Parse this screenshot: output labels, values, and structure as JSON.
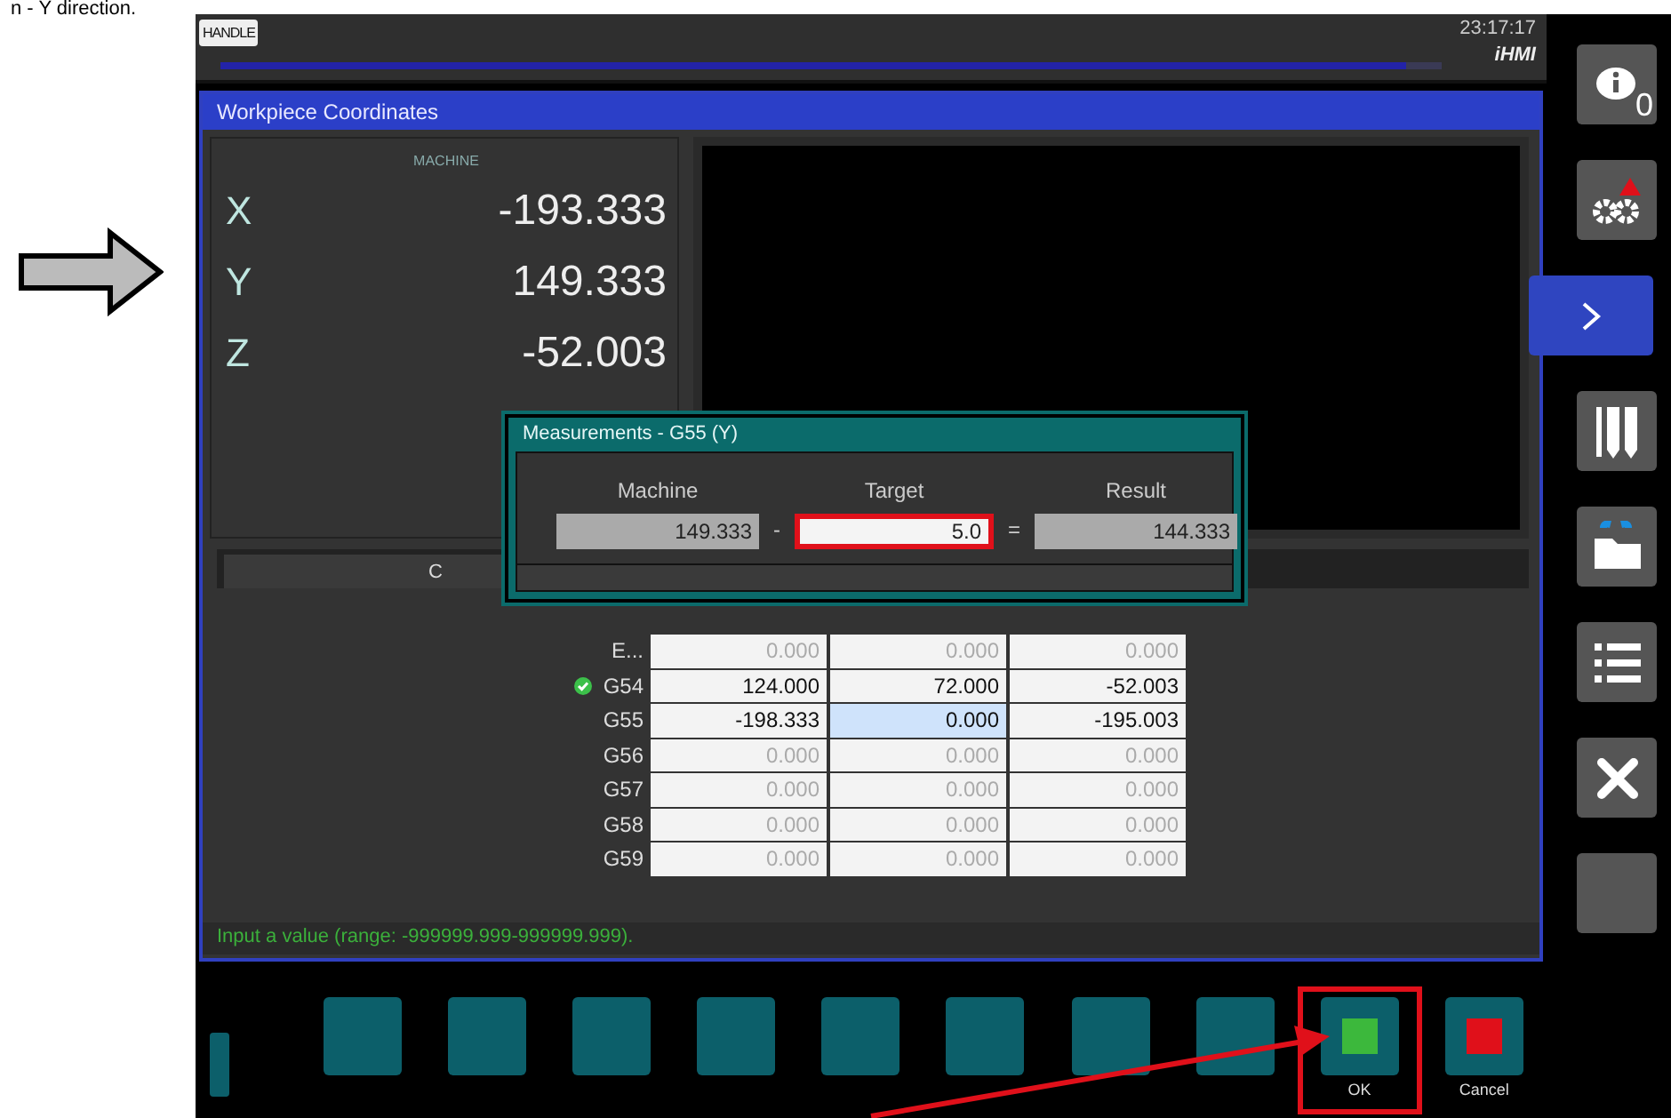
{
  "caption": "n - Y direction.",
  "header": {
    "mode_badge": "HANDLE",
    "progress": {
      "level": 0.97
    },
    "time": "23:17:17",
    "brand": "iHMI"
  },
  "sidebar": {
    "items": [
      {
        "kind": "info",
        "badge": "0",
        "selected": false
      },
      {
        "kind": "gears",
        "alert": true,
        "selected": false
      },
      {
        "kind": "chevron",
        "selected": true
      },
      {
        "kind": "tools",
        "selected": false
      },
      {
        "kind": "folder",
        "selected": false
      },
      {
        "kind": "list",
        "selected": false
      },
      {
        "kind": "wrench",
        "selected": false
      },
      {
        "kind": "blank",
        "selected": false
      }
    ]
  },
  "panel": {
    "title": "Workpiece Coordinates",
    "position": {
      "heading": "MACHINE",
      "axes": [
        {
          "axis": "X",
          "value": "-193.333"
        },
        {
          "axis": "Y",
          "value": "149.333"
        },
        {
          "axis": "Z",
          "value": "-52.003"
        }
      ]
    },
    "tab_label": "C",
    "table": {
      "rows": [
        {
          "name": "E...",
          "active": false,
          "cells": [
            {
              "value": "0.000",
              "set": false,
              "selected": false
            },
            {
              "value": "0.000",
              "set": false,
              "selected": false
            },
            {
              "value": "0.000",
              "set": false,
              "selected": false
            }
          ]
        },
        {
          "name": "G54",
          "active": true,
          "cells": [
            {
              "value": "124.000",
              "set": true,
              "selected": false
            },
            {
              "value": "72.000",
              "set": true,
              "selected": false
            },
            {
              "value": "-52.003",
              "set": true,
              "selected": false
            }
          ]
        },
        {
          "name": "G55",
          "active": false,
          "cells": [
            {
              "value": "-198.333",
              "set": true,
              "selected": false
            },
            {
              "value": "0.000",
              "set": true,
              "selected": true
            },
            {
              "value": "-195.003",
              "set": true,
              "selected": false
            }
          ]
        },
        {
          "name": "G56",
          "active": false,
          "cells": [
            {
              "value": "0.000",
              "set": false,
              "selected": false
            },
            {
              "value": "0.000",
              "set": false,
              "selected": false
            },
            {
              "value": "0.000",
              "set": false,
              "selected": false
            }
          ]
        },
        {
          "name": "G57",
          "active": false,
          "cells": [
            {
              "value": "0.000",
              "set": false,
              "selected": false
            },
            {
              "value": "0.000",
              "set": false,
              "selected": false
            },
            {
              "value": "0.000",
              "set": false,
              "selected": false
            }
          ]
        },
        {
          "name": "G58",
          "active": false,
          "cells": [
            {
              "value": "0.000",
              "set": false,
              "selected": false
            },
            {
              "value": "0.000",
              "set": false,
              "selected": false
            },
            {
              "value": "0.000",
              "set": false,
              "selected": false
            }
          ]
        },
        {
          "name": "G59",
          "active": false,
          "cells": [
            {
              "value": "0.000",
              "set": false,
              "selected": false
            },
            {
              "value": "0.000",
              "set": false,
              "selected": false
            },
            {
              "value": "0.000",
              "set": false,
              "selected": false
            }
          ]
        }
      ]
    },
    "status": "Input a value (range: -999999.999-999999.999)."
  },
  "dialog": {
    "title": "Measurements - G55 (Y)",
    "fields": [
      {
        "label": "Machine",
        "value": "149.333",
        "editable": false
      },
      {
        "label": "Target",
        "value": "5.0",
        "editable": true
      },
      {
        "label": "Result",
        "value": "144.333",
        "editable": false
      }
    ],
    "operators": [
      "-",
      "="
    ]
  },
  "softkeys": [
    {
      "kind": "blank"
    },
    {
      "kind": "blank"
    },
    {
      "kind": "blank"
    },
    {
      "kind": "blank"
    },
    {
      "kind": "blank"
    },
    {
      "kind": "blank"
    },
    {
      "kind": "blank"
    },
    {
      "kind": "blank"
    },
    {
      "kind": "ok",
      "label": "OK",
      "highlighted": true
    },
    {
      "kind": "cancel",
      "label": "Cancel",
      "highlighted": false
    }
  ]
}
